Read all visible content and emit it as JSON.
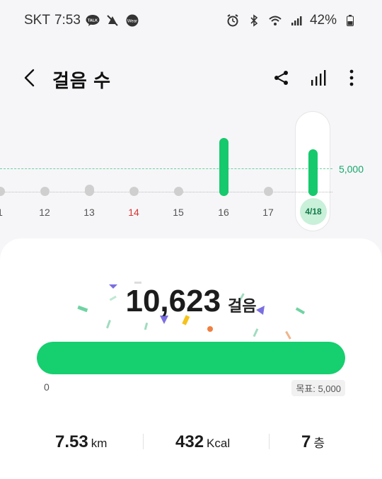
{
  "status_bar": {
    "carrier": "SKT",
    "time": "7:53",
    "battery": "42%"
  },
  "app_bar": {
    "title": "걸음 수"
  },
  "chart": {
    "goal_label": "5,000",
    "days": [
      {
        "label": "1",
        "steps": 0
      },
      {
        "label": "12",
        "steps": 0
      },
      {
        "label": "13",
        "steps": 400
      },
      {
        "label": "14",
        "steps": 0,
        "holiday": true
      },
      {
        "label": "15",
        "steps": 0
      },
      {
        "label": "16",
        "steps": 10400
      },
      {
        "label": "17",
        "steps": 0
      },
      {
        "label": "4/18",
        "steps": 8000,
        "selected": true
      }
    ]
  },
  "summary": {
    "steps_value": "10,623",
    "steps_unit": "걸음",
    "progress_fraction": 1.0,
    "min_label": "0",
    "goal_chip": "목표: 5,000",
    "distance_value": "7.53",
    "distance_unit": "km",
    "calories_value": "432",
    "calories_unit": "Kcal",
    "floors_value": "7",
    "floors_unit": "층"
  },
  "colors": {
    "accent": "#16cf6f",
    "goal_line": "#2fc07d",
    "holiday": "#d83333"
  }
}
